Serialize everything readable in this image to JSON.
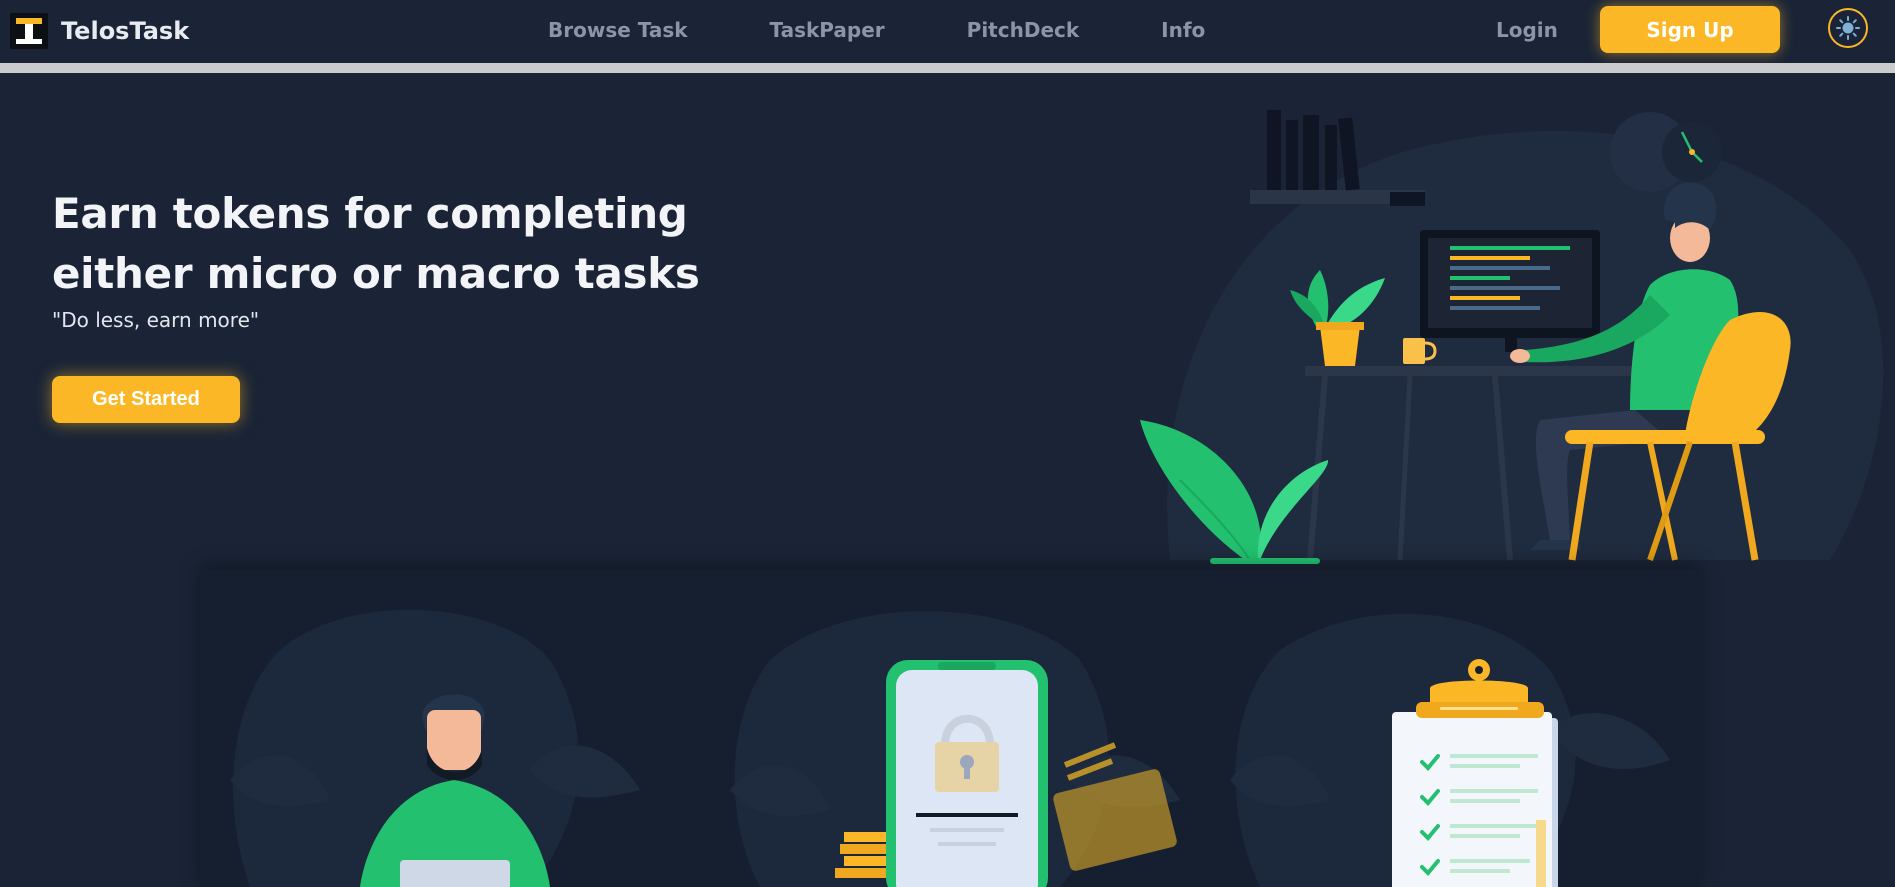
{
  "brand": {
    "name": "TelosTask",
    "accent": "#fbb726",
    "background": "#1a2436"
  },
  "nav": {
    "links": [
      {
        "label": "Browse Task"
      },
      {
        "label": "TaskPaper"
      },
      {
        "label": "PitchDeck"
      },
      {
        "label": "Info"
      }
    ],
    "login_label": "Login",
    "signup_label": "Sign Up",
    "theme_icon": "sun-icon"
  },
  "hero": {
    "title": "Earn tokens for completing either micro or macro tasks",
    "subtitle": "\"Do less, earn more\"",
    "cta_label": "Get Started"
  },
  "features": [
    {
      "icon": "person-with-laptop-illustration"
    },
    {
      "icon": "phone-lock-payment-illustration"
    },
    {
      "icon": "clipboard-checklist-illustration"
    }
  ]
}
